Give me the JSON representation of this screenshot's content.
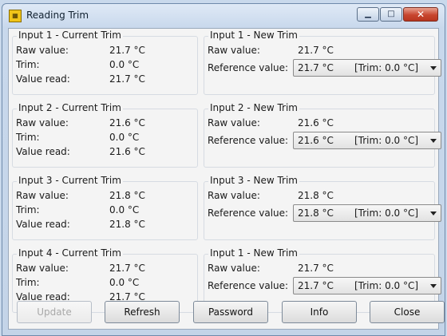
{
  "window": {
    "title": "Reading Trim",
    "icon": "app-icon"
  },
  "current": [
    {
      "legend": "Input 1 - Current Trim",
      "raw_label": "Raw value:",
      "raw": "21.7 °C",
      "trim_label": "Trim:",
      "trim": "0.0 °C",
      "read_label": "Value read:",
      "read": "21.7 °C"
    },
    {
      "legend": "Input 2 - Current Trim",
      "raw_label": "Raw value:",
      "raw": "21.6 °C",
      "trim_label": "Trim:",
      "trim": "0.0 °C",
      "read_label": "Value read:",
      "read": "21.6 °C"
    },
    {
      "legend": "Input 3 - Current Trim",
      "raw_label": "Raw value:",
      "raw": "21.8 °C",
      "trim_label": "Trim:",
      "trim": "0.0 °C",
      "read_label": "Value read:",
      "read": "21.8 °C"
    },
    {
      "legend": "Input 4 - Current Trim",
      "raw_label": "Raw value:",
      "raw": "21.7 °C",
      "trim_label": "Trim:",
      "trim": "0.0 °C",
      "read_label": "Value read:",
      "read": "21.7 °C"
    }
  ],
  "newtrim": [
    {
      "legend": "Input 1 - New Trim",
      "raw_label": "Raw value:",
      "raw": "21.7 °C",
      "ref_label": "Reference value:",
      "ref": "21.7 °C",
      "ref_trim": "[Trim: 0.0 °C]"
    },
    {
      "legend": "Input 2 - New Trim",
      "raw_label": "Raw value:",
      "raw": "21.6 °C",
      "ref_label": "Reference value:",
      "ref": "21.6 °C",
      "ref_trim": "[Trim: 0.0 °C]"
    },
    {
      "legend": "Input 3 - New Trim",
      "raw_label": "Raw value:",
      "raw": "21.8 °C",
      "ref_label": "Reference value:",
      "ref": "21.8 °C",
      "ref_trim": "[Trim: 0.0 °C]"
    },
    {
      "legend": "Input 1 - New Trim",
      "raw_label": "Raw value:",
      "raw": "21.7 °C",
      "ref_label": "Reference value:",
      "ref": "21.7 °C",
      "ref_trim": "[Trim: 0.0 °C]"
    }
  ],
  "buttons": {
    "update": "Update",
    "refresh": "Refresh",
    "password": "Password",
    "info": "Info",
    "close": "Close"
  },
  "colors": {
    "titlebar": "#c8d8ec",
    "close_button": "#c8452e",
    "panel": "#f4f4f4"
  }
}
